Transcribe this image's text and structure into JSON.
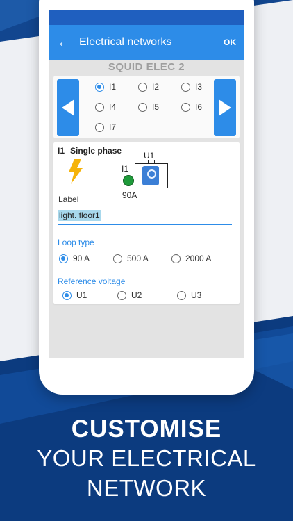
{
  "app": {
    "title": "Electrical networks",
    "ok_label": "OK",
    "device_name": "SQUID ELEC 2"
  },
  "channels": {
    "items": [
      {
        "label": "I1",
        "selected": true
      },
      {
        "label": "I2",
        "selected": false
      },
      {
        "label": "I3",
        "selected": false
      },
      {
        "label": "I4",
        "selected": false
      },
      {
        "label": "I5",
        "selected": false
      },
      {
        "label": "I6",
        "selected": false
      },
      {
        "label": "I7",
        "selected": false
      }
    ]
  },
  "detail": {
    "channel": "I1",
    "phase": "Single phase",
    "sensor_top_label": "U1",
    "sensor_left_label": "I1",
    "sensor_rating": "90A",
    "label_field_label": "Label",
    "label_value": "light. floor1",
    "loop_type_label": "Loop type",
    "loop_options": [
      {
        "label": "90 A",
        "selected": true
      },
      {
        "label": "500 A",
        "selected": false
      },
      {
        "label": "2000 A",
        "selected": false
      }
    ],
    "voltage_label": "Reference voltage",
    "voltage_options": [
      {
        "label": "U1",
        "selected": true
      },
      {
        "label": "U2",
        "selected": false
      },
      {
        "label": "U3",
        "selected": false
      }
    ]
  },
  "promo": {
    "line1": "CUSTOMISE",
    "line2": "YOUR ELECTRICAL",
    "line3": "NETWORK"
  },
  "colors": {
    "accent": "#2d8ce8",
    "background_blue": "#0c3b7f",
    "led_green": "#1e9a3a",
    "bolt_yellow": "#f5b30a"
  }
}
